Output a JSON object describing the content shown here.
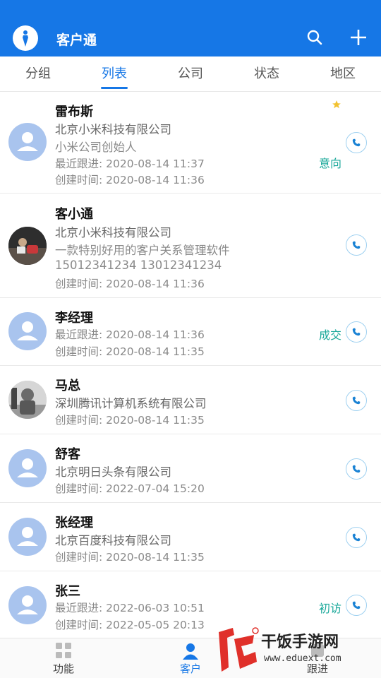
{
  "header": {
    "title": "客户通"
  },
  "tabs": [
    {
      "label": "分组"
    },
    {
      "label": "列表",
      "active": true
    },
    {
      "label": "公司"
    },
    {
      "label": "状态"
    },
    {
      "label": "地区"
    }
  ],
  "customers": [
    {
      "name": "雷布斯",
      "lines": [
        "北京小米科技有限公司",
        "小米公司创始人",
        "最近跟进: 2020-08-14 11:37",
        "创建时间: 2020-08-14 11:36"
      ],
      "status": "意向",
      "starred": true,
      "avatar": "default"
    },
    {
      "name": "客小通",
      "lines": [
        "北京小米科技有限公司",
        "一款特别好用的客户关系管理软件",
        "15012341234 13012341234",
        "创建时间: 2020-08-14 11:36"
      ],
      "status": "",
      "avatar": "photo-dark"
    },
    {
      "name": "李经理",
      "lines": [
        "最近跟进: 2020-08-14 11:36",
        "创建时间: 2020-08-14 11:35"
      ],
      "status": "成交",
      "avatar": "default"
    },
    {
      "name": "马总",
      "lines": [
        "深圳腾讯计算机系统有限公司",
        "创建时间: 2020-08-14 11:35"
      ],
      "status": "",
      "avatar": "photo-statue"
    },
    {
      "name": "舒客",
      "lines": [
        "北京明日头条有限公司",
        "创建时间: 2022-07-04 15:20"
      ],
      "status": "",
      "avatar": "default"
    },
    {
      "name": "张经理",
      "lines": [
        "北京百度科技有限公司",
        "创建时间: 2020-08-14 11:35"
      ],
      "status": "",
      "avatar": "default"
    },
    {
      "name": "张三",
      "lines": [
        "最近跟进: 2022-06-03 10:51",
        "创建时间: 2022-05-05 20:13"
      ],
      "status": "初访",
      "avatar": "default"
    }
  ],
  "bottom_nav": [
    {
      "label": "功能",
      "icon": "grid-icon"
    },
    {
      "label": "客户",
      "icon": "person-icon",
      "active": true
    },
    {
      "label": "跟进",
      "icon": "followup-icon"
    }
  ],
  "watermark": {
    "text": "干饭手游网",
    "url": "www.eduext.com"
  },
  "colors": {
    "primary": "#1677e6",
    "status": "#1aa89a",
    "avatar_default": "#a9c4ee"
  }
}
